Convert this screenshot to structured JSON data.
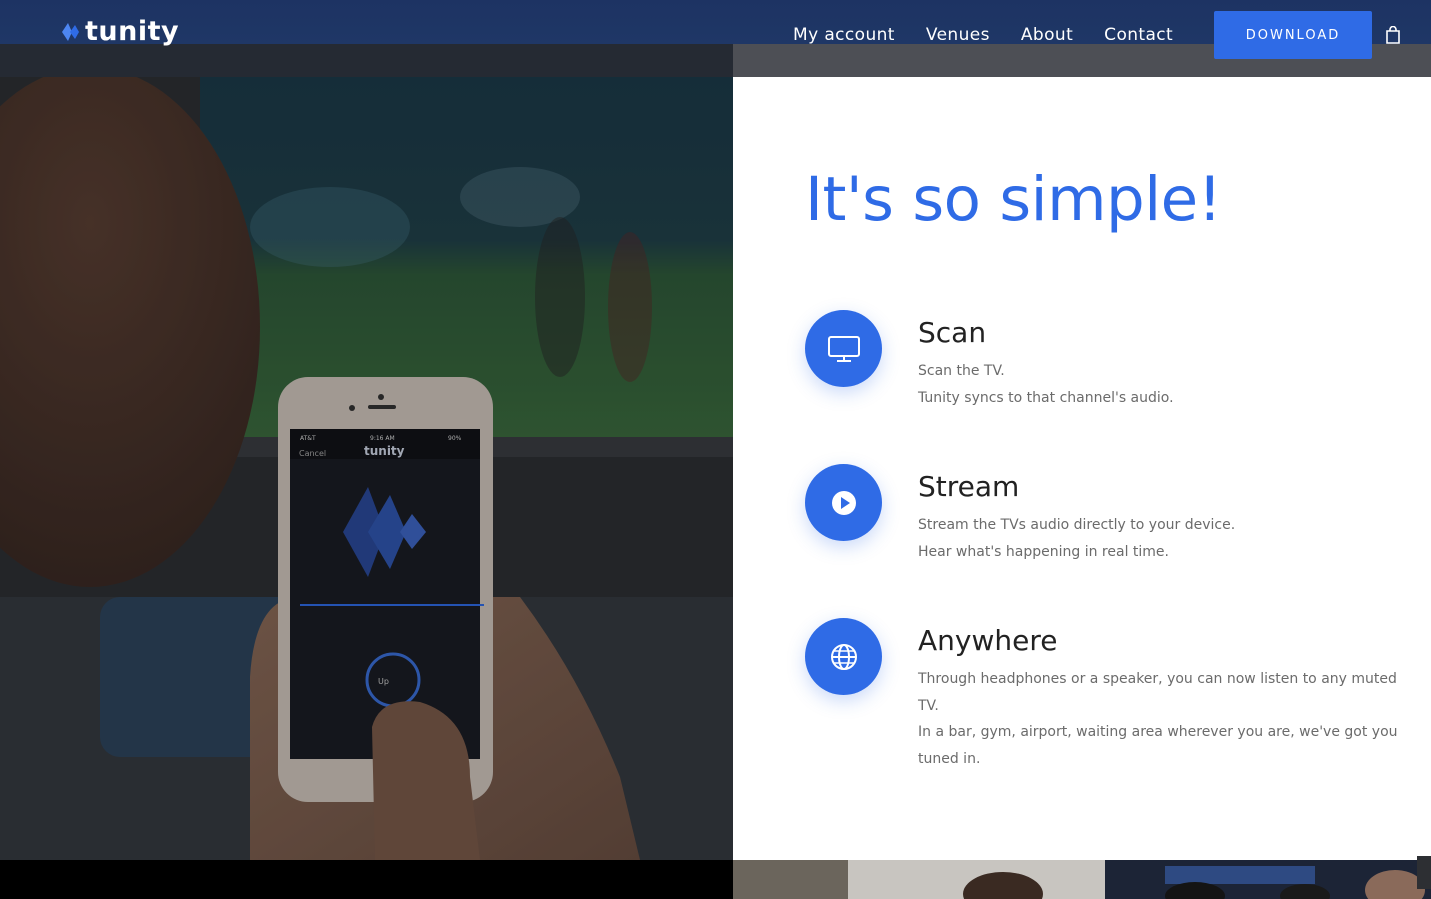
{
  "header": {
    "logo_text": "tunity",
    "nav": [
      {
        "label": "My account"
      },
      {
        "label": "Venues"
      },
      {
        "label": "About"
      },
      {
        "label": "Contact"
      }
    ],
    "download_label": "DOWNLOAD",
    "cart_icon": "shopping-bag-icon"
  },
  "main": {
    "heading": "It's so simple!",
    "features": [
      {
        "icon": "tv-icon",
        "title": "Scan",
        "lines": [
          "Scan the TV.",
          "Tunity syncs to that channel's audio."
        ]
      },
      {
        "icon": "play-icon",
        "title": "Stream",
        "lines": [
          "Stream the TVs audio directly to your device.",
          "Hear what's happening in real time."
        ]
      },
      {
        "icon": "globe-icon",
        "title": "Anywhere",
        "lines": [
          "Through headphones or a speaker, you can now listen to any muted TV.",
          "In a bar, gym, airport, waiting area wherever you are, we've got you tuned in."
        ]
      }
    ]
  },
  "photo": {
    "phone_carrier": "AT&T",
    "phone_time": "9:16 AM",
    "phone_battery": "90%",
    "phone_cancel": "Cancel",
    "phone_app_name": "tunity",
    "phone_button": "Up"
  },
  "colors": {
    "accent": "#2f6be6",
    "header": "#1d3363",
    "heading_text": "#222222",
    "body_text": "#6b6b6b"
  }
}
